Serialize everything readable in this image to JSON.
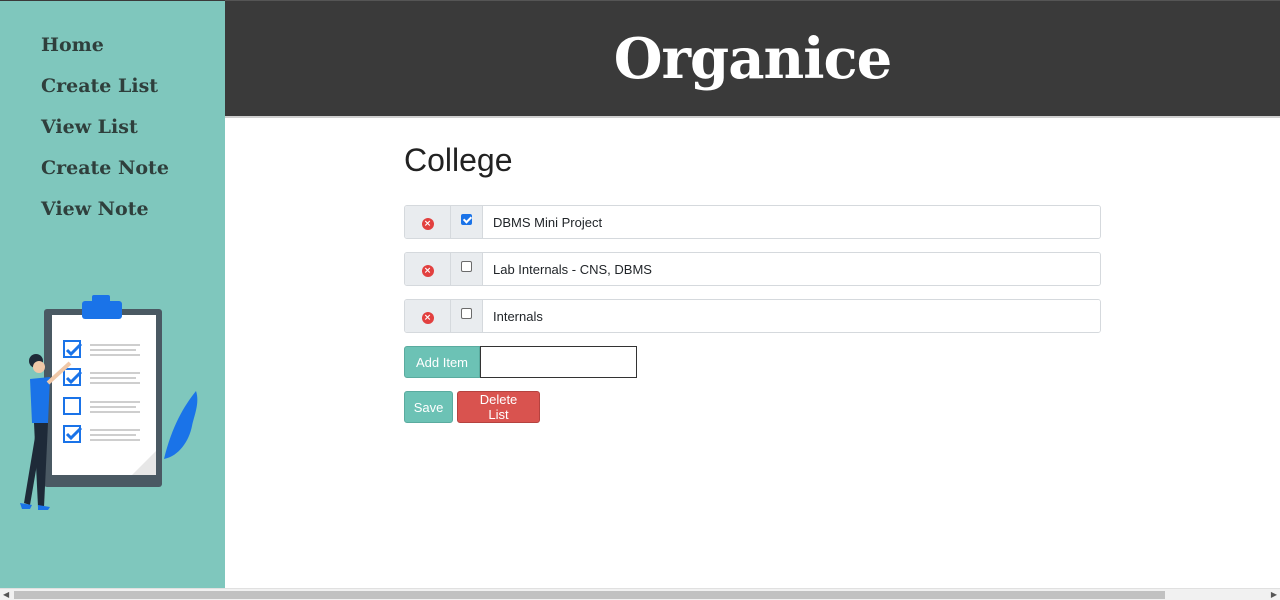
{
  "app": {
    "brand": "Organice"
  },
  "sidebar": {
    "items": [
      {
        "label": "Home"
      },
      {
        "label": "Create List"
      },
      {
        "label": "View List"
      },
      {
        "label": "Create Note"
      },
      {
        "label": "View Note"
      }
    ]
  },
  "list": {
    "title": "College",
    "items": [
      {
        "text": "DBMS Mini Project",
        "checked": true
      },
      {
        "text": "Lab Internals - CNS, DBMS",
        "checked": false
      },
      {
        "text": "Internals",
        "checked": false
      }
    ]
  },
  "controls": {
    "add_item_label": "Add Item",
    "add_item_value": "",
    "save_label": "Save",
    "delete_list_label": "Delete List"
  },
  "icons": {
    "delete": "remove-circle-icon",
    "illustration": "checklist-illustration"
  },
  "colors": {
    "sidebar": "#7fc7bd",
    "header": "#3a3a3a",
    "teal_button": "#6cc2b5",
    "red_button": "#d9534f",
    "remove_icon": "#e2403f"
  }
}
